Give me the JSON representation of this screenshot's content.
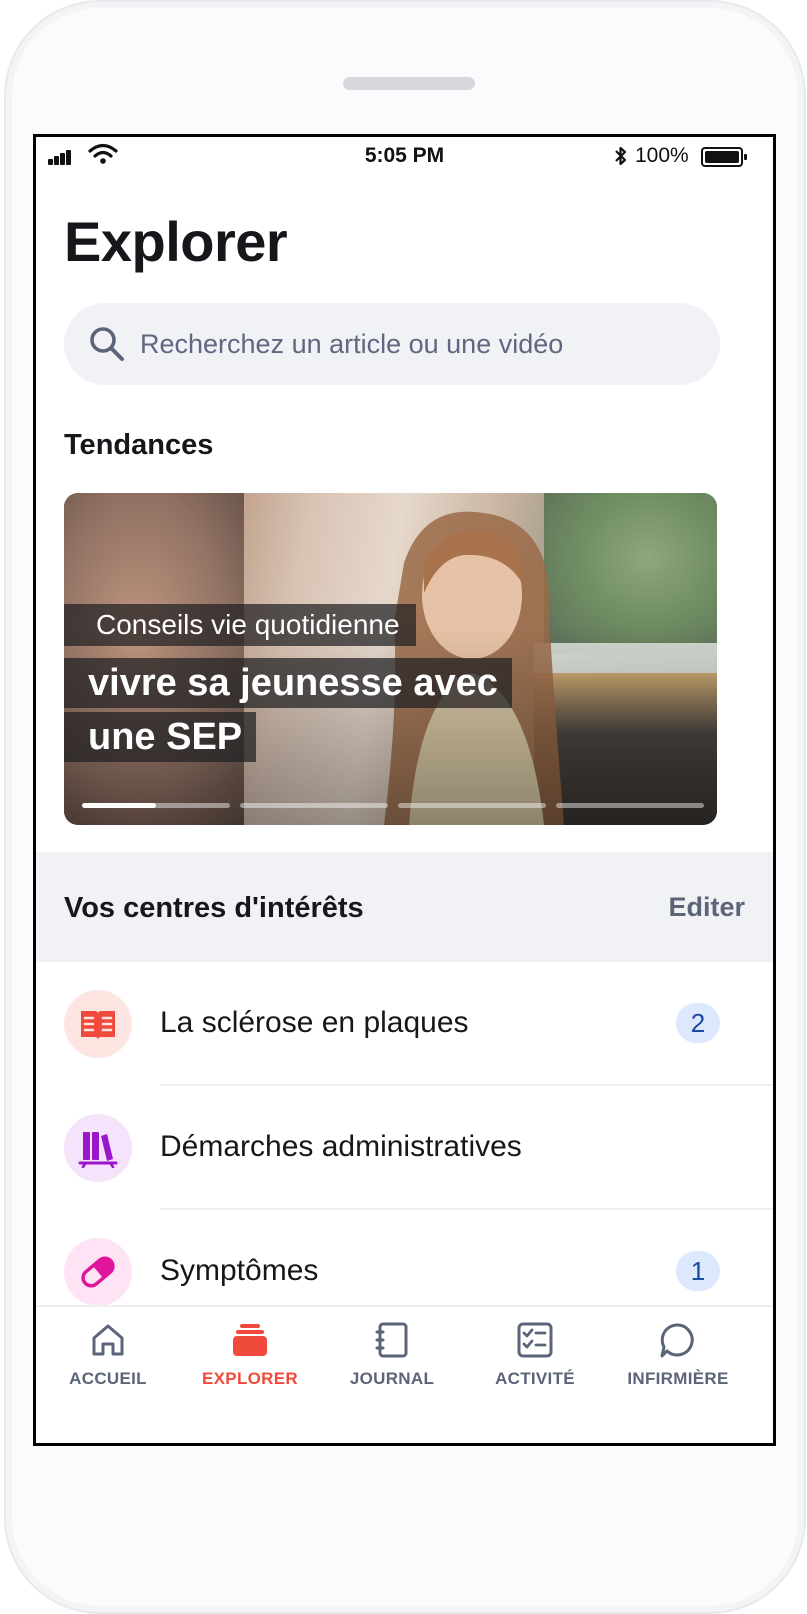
{
  "status_bar": {
    "time": "5:05 PM",
    "battery_percent": "100%",
    "battery_level": 1.0
  },
  "page": {
    "title": "Explorer"
  },
  "search": {
    "placeholder": "Recherchez un article ou une vidéo"
  },
  "trending": {
    "title": "Tendances",
    "card": {
      "category": "Conseils vie quotidienne",
      "headline": "vivre sa jeunesse avec une SEP"
    },
    "slides": {
      "count": 4,
      "current_index": 0,
      "current_progress": 0.5
    }
  },
  "interests": {
    "title": "Vos centres d'intérêts",
    "edit_label": "Editer",
    "items": [
      {
        "label": "La sclérose en plaques",
        "badge": "2",
        "icon": "book-icon",
        "icon_color": "#ef4a3c",
        "circle_color": "#fde6e2"
      },
      {
        "label": "Démarches administratives",
        "badge": "",
        "icon": "books-shelf-icon",
        "icon_color": "#9b16c9",
        "circle_color": "#f5e3fb"
      },
      {
        "label": "Symptômes",
        "badge": "1",
        "icon": "pill-icon",
        "icon_color": "#e0159c",
        "circle_color": "#fde3f3"
      }
    ]
  },
  "tabbar": {
    "active": "EXPLORER",
    "active_color": "#ef4a3c",
    "inactive_color": "#5c6479",
    "tabs": [
      {
        "label": "ACCUEIL",
        "icon": "home-icon"
      },
      {
        "label": "EXPLORER",
        "icon": "stack-icon"
      },
      {
        "label": "JOURNAL",
        "icon": "notebook-icon"
      },
      {
        "label": "ACTIVITÉ",
        "icon": "checklist-icon"
      },
      {
        "label": "INFIRMIÈRE",
        "icon": "chat-icon"
      }
    ]
  }
}
